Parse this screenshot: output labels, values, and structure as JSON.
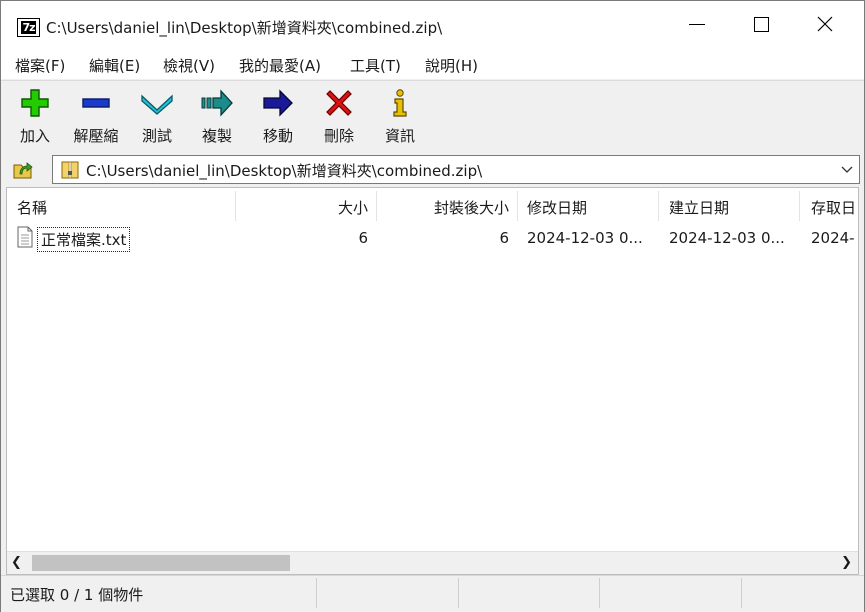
{
  "window": {
    "title": "C:\\Users\\daniel_lin\\Desktop\\新增資料夾\\combined.zip\\",
    "app_icon_text": "7z"
  },
  "menu": [
    "檔案(F)",
    "編輯(E)",
    "檢視(V)",
    "我的最愛(A)",
    "工具(T)",
    "說明(H)"
  ],
  "toolbar": [
    {
      "label": "加入",
      "icon": "add-icon",
      "color": "#22cc00"
    },
    {
      "label": "解壓縮",
      "icon": "extract-icon",
      "color": "#1a3acc"
    },
    {
      "label": "測試",
      "icon": "test-icon",
      "color": "#22b0c8"
    },
    {
      "label": "複製",
      "icon": "copy-icon",
      "color": "#1a8c8c"
    },
    {
      "label": "移動",
      "icon": "move-icon",
      "color": "#1a1a99"
    },
    {
      "label": "刪除",
      "icon": "delete-icon",
      "color": "#dd1111"
    },
    {
      "label": "資訊",
      "icon": "info-icon",
      "color": "#d4b000"
    }
  ],
  "address": {
    "path": "C:\\Users\\daniel_lin\\Desktop\\新增資料夾\\combined.zip\\"
  },
  "columns": [
    "名稱",
    "大小",
    "封裝後大小",
    "修改日期",
    "建立日期",
    "存取日"
  ],
  "files": [
    {
      "name": "正常檔案.txt",
      "size": "6",
      "packed": "6",
      "modified": "2024-12-03 0...",
      "created": "2024-12-03 0...",
      "accessed": "2024-"
    }
  ],
  "status": {
    "text": "已選取 0 / 1 個物件"
  }
}
